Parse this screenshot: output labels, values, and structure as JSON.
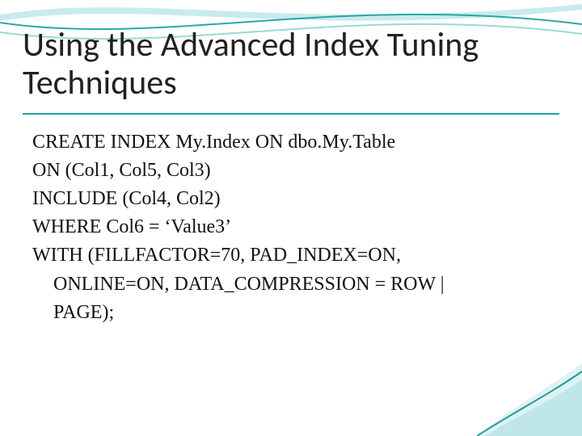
{
  "title": "Using the Advanced Index Tuning Techniques",
  "code": {
    "l1": "CREATE INDEX My.Index ON dbo.My.Table",
    "l2": "ON (Col1, Col5, Col3)",
    "l3": "INCLUDE (Col4, Col2)",
    "l4": "WHERE Col6 = ‘Value3’",
    "l5": "WITH (FILLFACTOR=70, PAD_INDEX=ON,",
    "l6": "ONLINE=ON, DATA_COMPRESSION = ROW |",
    "l7": "PAGE);"
  }
}
